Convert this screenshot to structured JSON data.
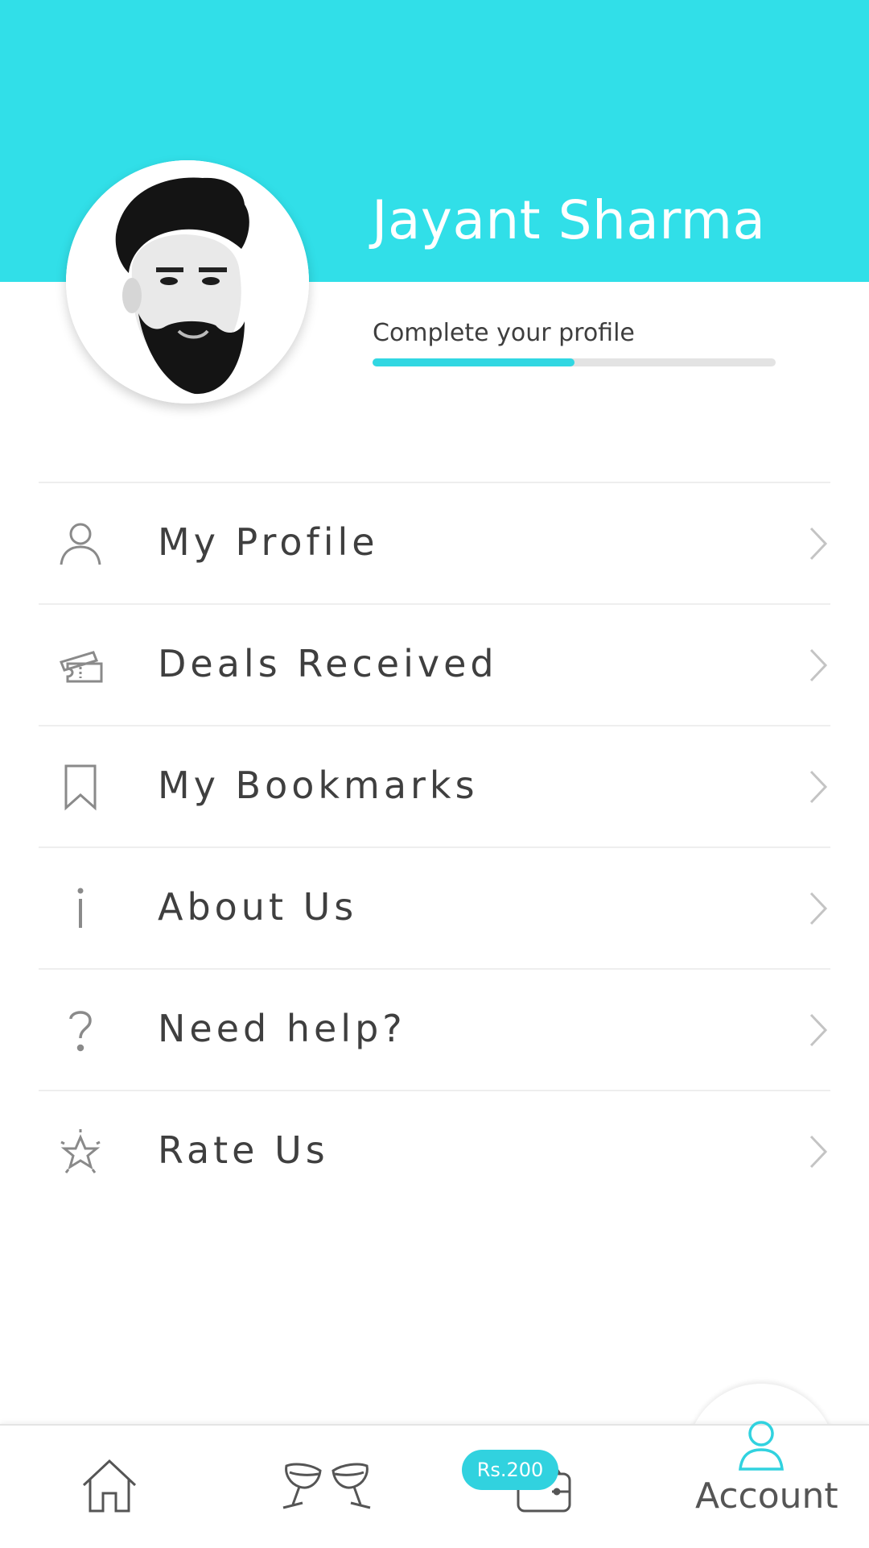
{
  "profile": {
    "name": "Jayant Sharma",
    "complete_prompt": "Complete your profile",
    "completion": 0.5
  },
  "menu": [
    {
      "label": "My Profile",
      "icon": "user-icon"
    },
    {
      "label": "Deals Received",
      "icon": "ticket-icon"
    },
    {
      "label": "My Bookmarks",
      "icon": "bookmark-icon"
    },
    {
      "label": "About Us",
      "icon": "info-icon"
    },
    {
      "label": "Need help?",
      "icon": "help-icon"
    },
    {
      "label": "Rate Us",
      "icon": "star-icon"
    }
  ],
  "bottom_nav": {
    "wallet_badge": "Rs.200",
    "account_label": "Account",
    "icons": [
      "home-icon",
      "cheers-icon",
      "wallet-icon",
      "account-icon"
    ]
  },
  "colors": {
    "accent": "#31dfe8",
    "progress": "#31d7e2",
    "badge": "#31d2df"
  }
}
